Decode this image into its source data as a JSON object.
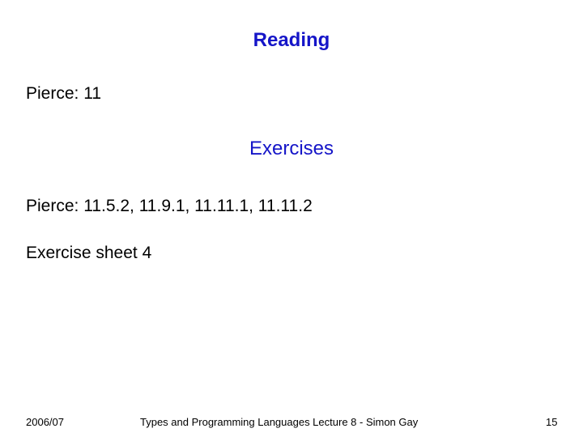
{
  "slide": {
    "sections": [
      {
        "heading": "Reading",
        "items": [
          "Pierce: 11"
        ]
      },
      {
        "heading": "Exercises",
        "items": [
          "Pierce: 11.5.2, 11.9.1, 11.11.1, 11.11.2",
          "Exercise sheet 4"
        ]
      }
    ]
  },
  "footer": {
    "date": "2006/07",
    "title": "Types and Programming Languages Lecture 8 - Simon Gay",
    "page_number": "15"
  },
  "colors": {
    "heading": "#1515c8"
  }
}
